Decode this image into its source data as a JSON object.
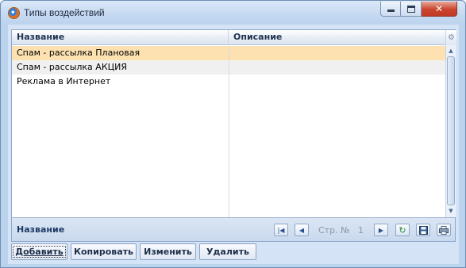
{
  "window": {
    "title": "Типы воздействий"
  },
  "titlebar": {
    "minimize_icon": "minimize-icon",
    "maximize_icon": "maximize-icon",
    "close_icon": "close-icon",
    "close_glyph": "✕"
  },
  "grid": {
    "columns": [
      "Название",
      "Описание"
    ],
    "rows": [
      {
        "name": "Спам - рассылка Плановая",
        "description": "",
        "state": "selected"
      },
      {
        "name": "Спам - рассылка АКЦИЯ",
        "description": "",
        "state": "alt"
      },
      {
        "name": "Реклама в Интернет",
        "description": "",
        "state": "normal"
      }
    ]
  },
  "footer": {
    "column_label": "Название",
    "page_label": "Стр. №",
    "page_number": "1"
  },
  "buttons": {
    "add": "Добавить",
    "copy": "Копировать",
    "edit": "Изменить",
    "delete": "Удалить"
  },
  "colors": {
    "selected_row": "#fde1b0",
    "alt_row": "#f0f0f0",
    "window_frame": "#bcd3ee"
  }
}
